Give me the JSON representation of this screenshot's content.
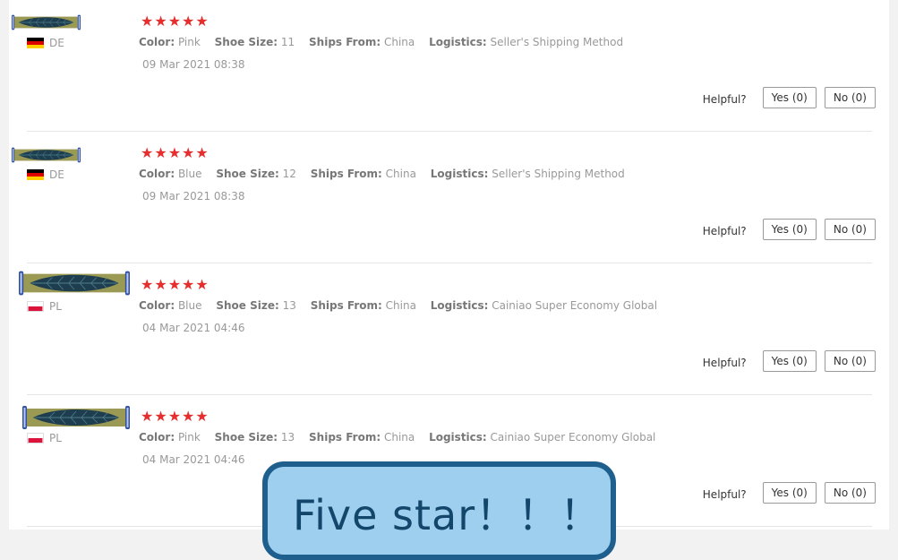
{
  "colors": {
    "star": "#e62e2e",
    "overlay_bg": "#9ecfee",
    "overlay_border": "#1f5f8d",
    "overlay_text": "#12466a"
  },
  "labels": {
    "color": "Color:",
    "shoe_size": "Shoe Size:",
    "ships_from": "Ships From:",
    "logistics": "Logistics:",
    "helpful": "Helpful?"
  },
  "reviews": [
    {
      "country": "DE",
      "flag": "germany-flag",
      "rating": 5,
      "stars": "★★★★★",
      "color": "Pink",
      "shoe_size": "11",
      "ships_from": "China",
      "logistics": "Seller's Shipping Method",
      "date": "09 Mar 2021 08:38",
      "yes": "Yes (0)",
      "no": "No (0)"
    },
    {
      "country": "DE",
      "flag": "germany-flag",
      "rating": 5,
      "stars": "★★★★★",
      "color": "Blue",
      "shoe_size": "12",
      "ships_from": "China",
      "logistics": "Seller's Shipping Method",
      "date": "09 Mar 2021 08:38",
      "yes": "Yes (0)",
      "no": "No (0)"
    },
    {
      "country": "PL",
      "flag": "poland-flag",
      "rating": 5,
      "stars": "★★★★★",
      "color": "Blue",
      "shoe_size": "13",
      "ships_from": "China",
      "logistics": "Cainiao Super Economy Global",
      "date": "04 Mar 2021 04:46",
      "yes": "Yes (0)",
      "no": "No (0)"
    },
    {
      "country": "PL",
      "flag": "poland-flag",
      "rating": 5,
      "stars": "★★★★★",
      "color": "Pink",
      "shoe_size": "13",
      "ships_from": "China",
      "logistics": "Cainiao Super Economy Global",
      "date": "04 Mar 2021 04:46",
      "yes": "Yes (0)",
      "no": "No (0)"
    }
  ],
  "overlay": {
    "text": "Five star！！！"
  }
}
